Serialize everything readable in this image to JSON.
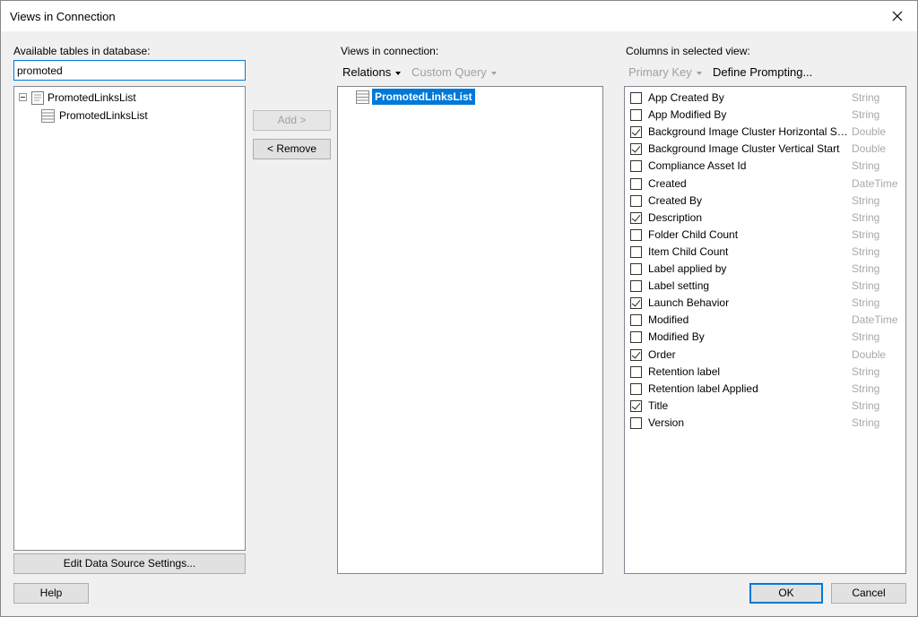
{
  "window": {
    "title": "Views in Connection"
  },
  "left": {
    "label": "Available tables in database:",
    "search_value": "promoted",
    "tree": [
      {
        "label": "PromotedLinksList",
        "icon": "document-icon",
        "expanded": true
      },
      {
        "label": "PromotedLinksList",
        "icon": "table-icon"
      }
    ],
    "edit_button": "Edit Data Source Settings..."
  },
  "middle": {
    "add_button": "Add >",
    "remove_button": "< Remove"
  },
  "views": {
    "label": "Views in connection:",
    "relations": "Relations",
    "custom_query": "Custom Query",
    "items": [
      {
        "label": "PromotedLinksList",
        "icon": "table-icon",
        "selected": true
      }
    ]
  },
  "columns": {
    "label": "Columns in selected view:",
    "primary_key": "Primary Key",
    "define_prompting": "Define Prompting...",
    "rows": [
      {
        "name": "App Created By",
        "type": "String",
        "checked": false
      },
      {
        "name": "App Modified By",
        "type": "String",
        "checked": false
      },
      {
        "name": "Background Image Cluster Horizontal St...",
        "type": "Double",
        "checked": true
      },
      {
        "name": "Background Image Cluster Vertical Start",
        "type": "Double",
        "checked": true
      },
      {
        "name": "Compliance Asset Id",
        "type": "String",
        "checked": false
      },
      {
        "name": "Created",
        "type": "DateTime",
        "checked": false
      },
      {
        "name": "Created By",
        "type": "String",
        "checked": false
      },
      {
        "name": "Description",
        "type": "String",
        "checked": true
      },
      {
        "name": "Folder Child Count",
        "type": "String",
        "checked": false
      },
      {
        "name": "Item Child Count",
        "type": "String",
        "checked": false
      },
      {
        "name": "Label applied by",
        "type": "String",
        "checked": false
      },
      {
        "name": "Label setting",
        "type": "String",
        "checked": false
      },
      {
        "name": "Launch Behavior",
        "type": "String",
        "checked": true
      },
      {
        "name": "Modified",
        "type": "DateTime",
        "checked": false
      },
      {
        "name": "Modified By",
        "type": "String",
        "checked": false
      },
      {
        "name": "Order",
        "type": "Double",
        "checked": true
      },
      {
        "name": "Retention label",
        "type": "String",
        "checked": false
      },
      {
        "name": "Retention label Applied",
        "type": "String",
        "checked": false
      },
      {
        "name": "Title",
        "type": "String",
        "checked": true
      },
      {
        "name": "Version",
        "type": "String",
        "checked": false
      }
    ]
  },
  "footer": {
    "help": "Help",
    "ok": "OK",
    "cancel": "Cancel"
  },
  "colors": {
    "accent": "#0078d7",
    "type_text": "#a8a8a8"
  }
}
